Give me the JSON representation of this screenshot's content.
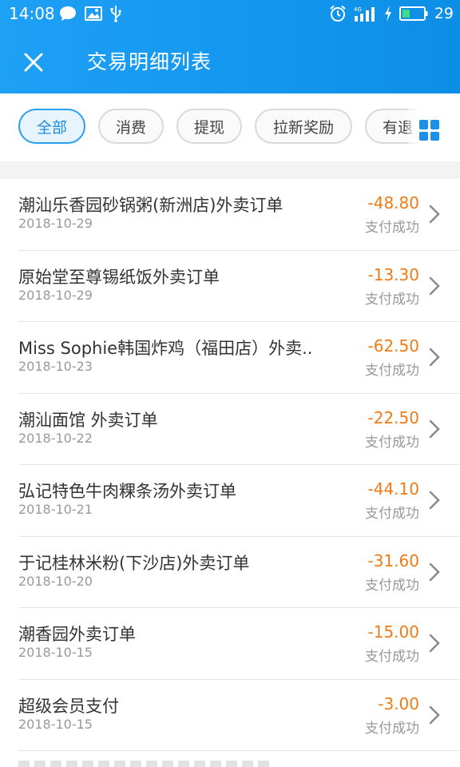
{
  "status_bar": {
    "time": "14:08",
    "battery": "29",
    "icons": [
      "chat-bubble-icon",
      "image-icon",
      "usb-icon",
      "alarm-icon",
      "signal-icon",
      "charging-icon",
      "battery-icon"
    ]
  },
  "header": {
    "title": "交易明细列表",
    "close_icon": "close-icon"
  },
  "filters": {
    "chips": [
      "全部",
      "消费",
      "提现",
      "拉新奖励",
      "有退"
    ],
    "active_index": 0,
    "grid_icon": "grid-icon"
  },
  "transactions": [
    {
      "title": "潮汕乐香园砂锅粥(新洲店)外卖订单",
      "date": "2018-10-29",
      "amount": "-48.80",
      "status": "支付成功"
    },
    {
      "title": "原始堂至尊锡纸饭外卖订单",
      "date": "2018-10-29",
      "amount": "-13.30",
      "status": "支付成功"
    },
    {
      "title": "Miss Sophie韩国炸鸡（福田店）外卖..",
      "date": "2018-10-23",
      "amount": "-62.50",
      "status": "支付成功"
    },
    {
      "title": "潮汕面馆 外卖订单",
      "date": "2018-10-22",
      "amount": "-22.50",
      "status": "支付成功"
    },
    {
      "title": "弘记特色牛肉粿条汤外卖订单",
      "date": "2018-10-21",
      "amount": "-44.10",
      "status": "支付成功"
    },
    {
      "title": "于记桂林米粉(下沙店)外卖订单",
      "date": "2018-10-20",
      "amount": "-31.60",
      "status": "支付成功"
    },
    {
      "title": "潮香园外卖订单",
      "date": "2018-10-15",
      "amount": "-15.00",
      "status": "支付成功"
    },
    {
      "title": "超级会员支付",
      "date": "2018-10-15",
      "amount": "-3.00",
      "status": "支付成功"
    }
  ],
  "colors": {
    "header_blue": "#1296ee",
    "accent_blue": "#1a8de6",
    "amount_orange": "#f07a14",
    "muted_text": "#999999"
  }
}
